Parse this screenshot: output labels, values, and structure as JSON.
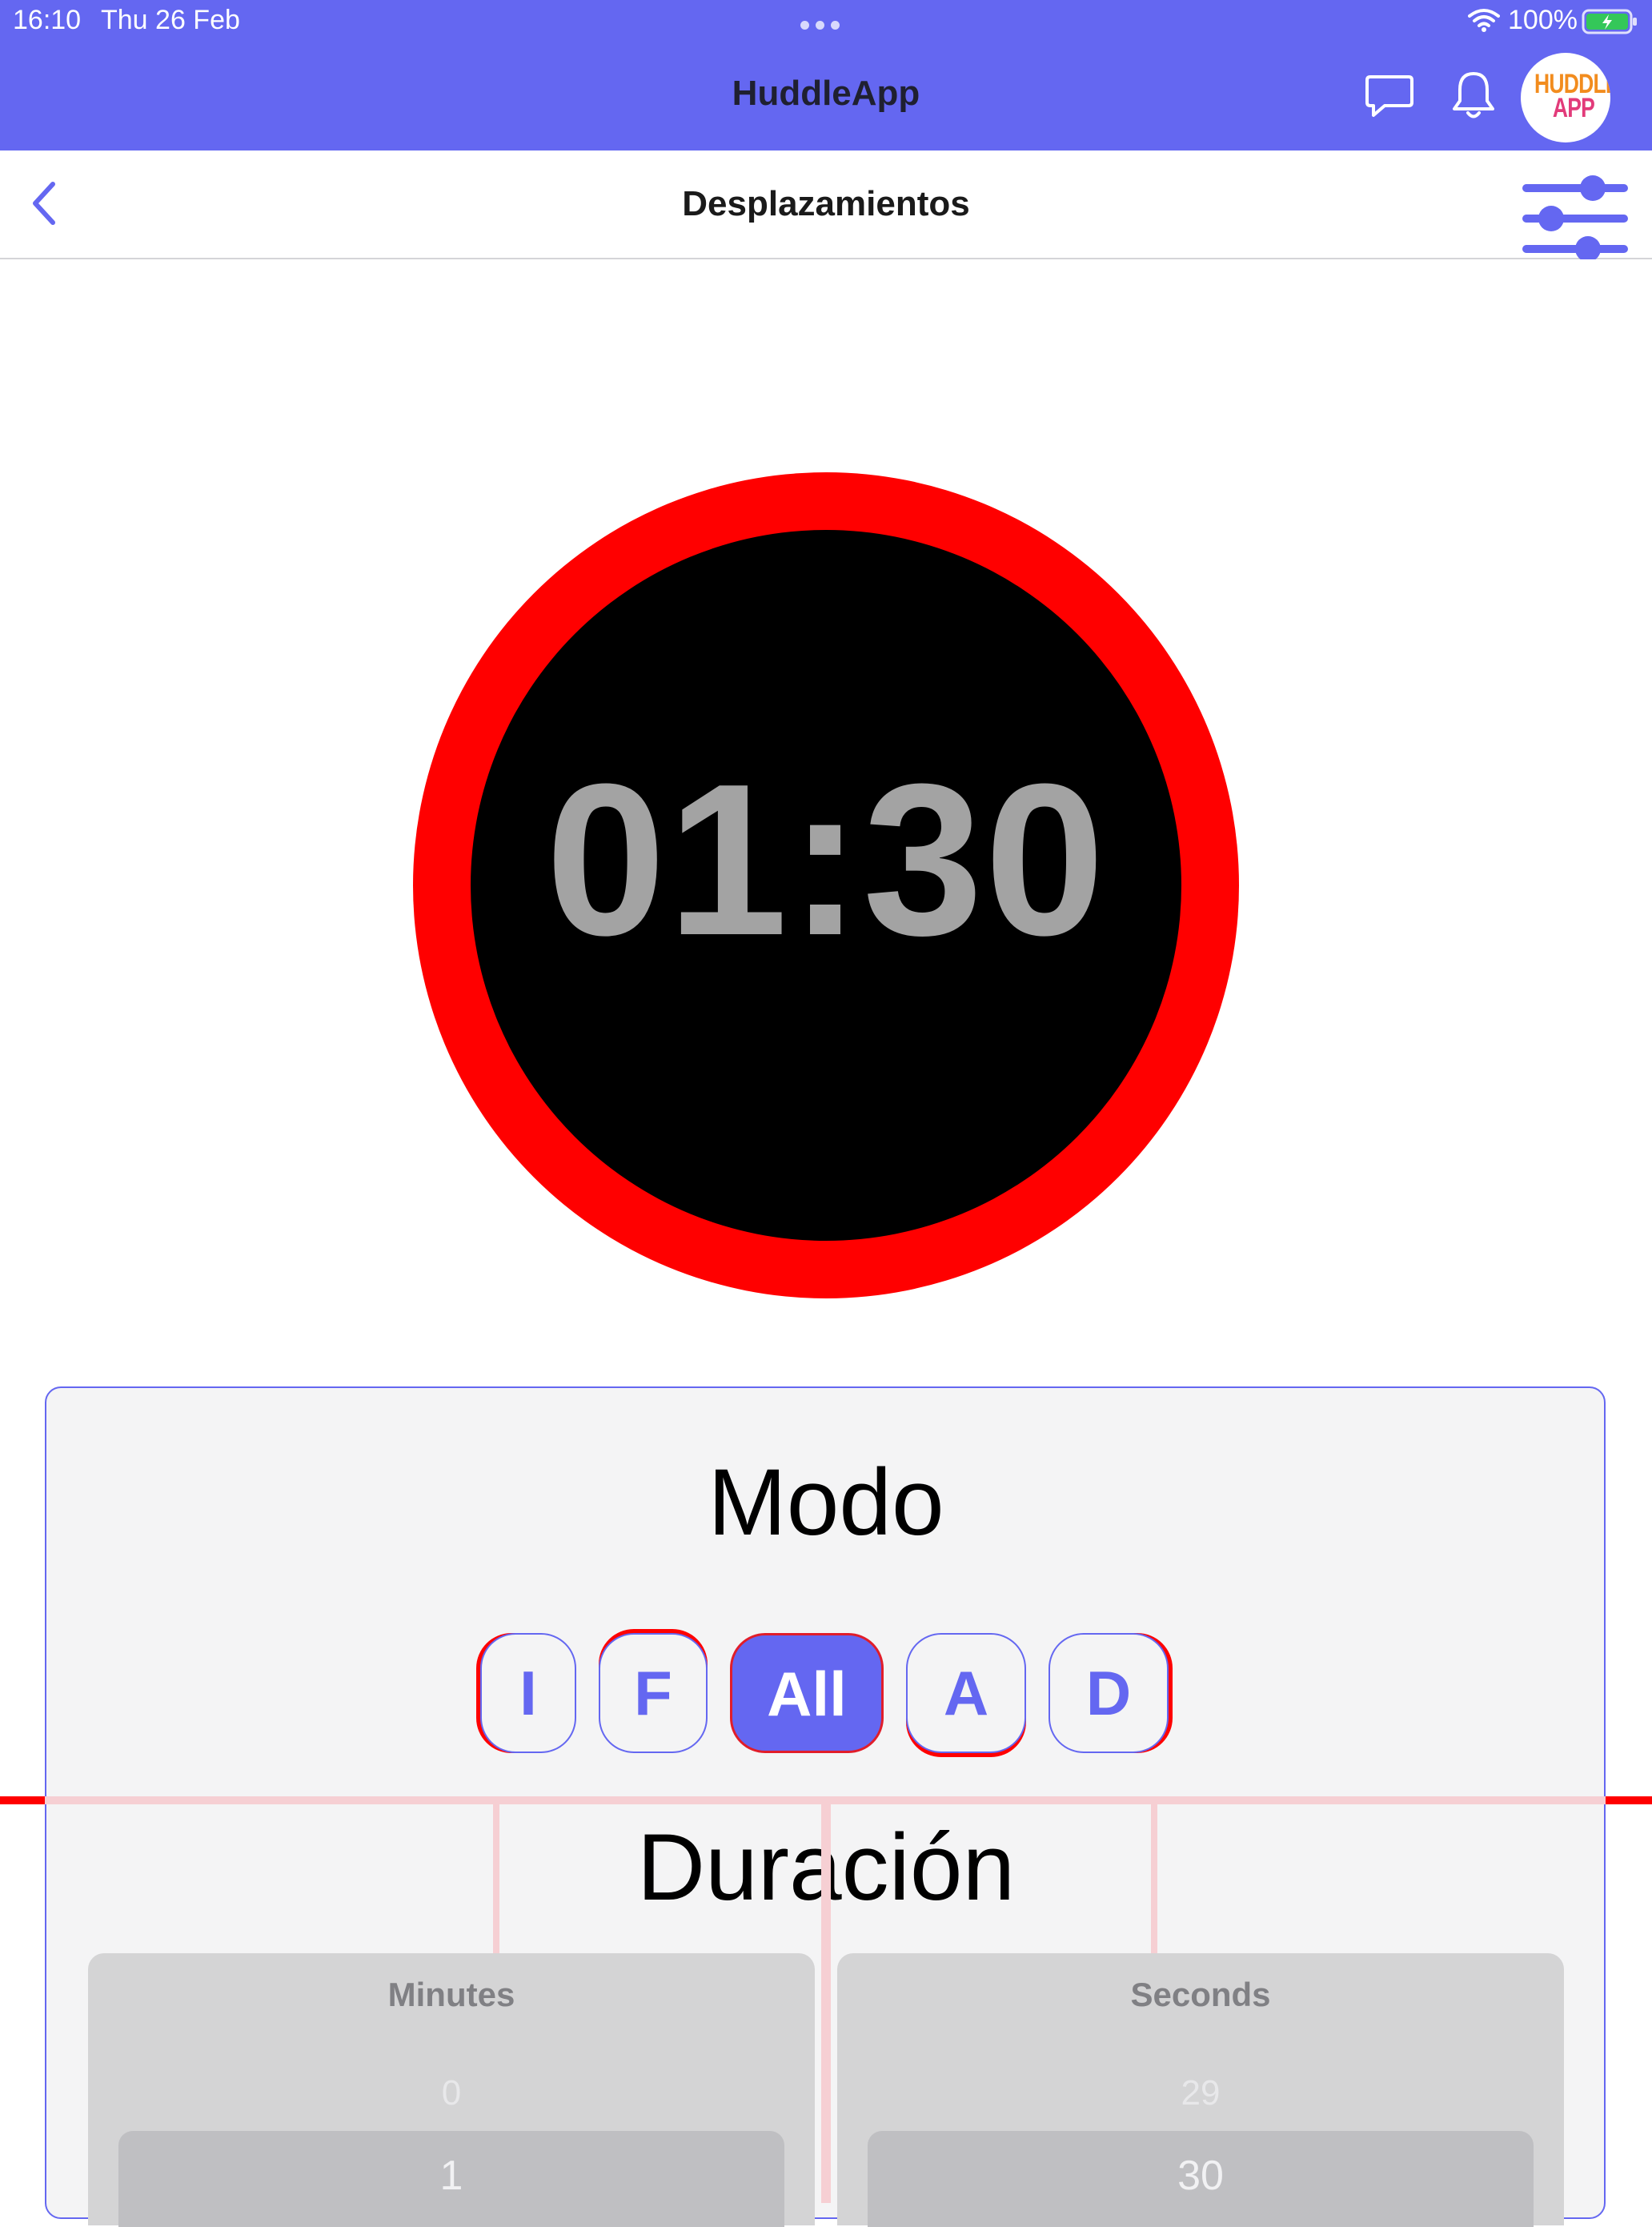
{
  "status_bar": {
    "time": "16:10",
    "date": "Thu 26 Feb",
    "battery": "100%"
  },
  "header": {
    "title": "HuddleApp",
    "avatar_line1": "HUDDLE",
    "avatar_line2": "APP"
  },
  "nav": {
    "title": "Desplazamientos"
  },
  "timer": {
    "value": "01:30",
    "ring_color": "#ff0000",
    "face_color": "#000000"
  },
  "mode": {
    "title": "Modo",
    "options": [
      "I",
      "F",
      "All",
      "A",
      "D"
    ],
    "selected": "All"
  },
  "duration": {
    "title": "Duración",
    "minutes": {
      "label": "Minutes",
      "previous": "0",
      "selected": "1"
    },
    "seconds": {
      "label": "Seconds",
      "previous": "29",
      "selected": "30"
    }
  },
  "colors": {
    "accent": "#6467F1",
    "alert": "#ff0000"
  },
  "icons": [
    "wifi-icon",
    "battery-icon",
    "chat-icon",
    "bell-icon",
    "back-icon",
    "filter-sliders-icon"
  ]
}
